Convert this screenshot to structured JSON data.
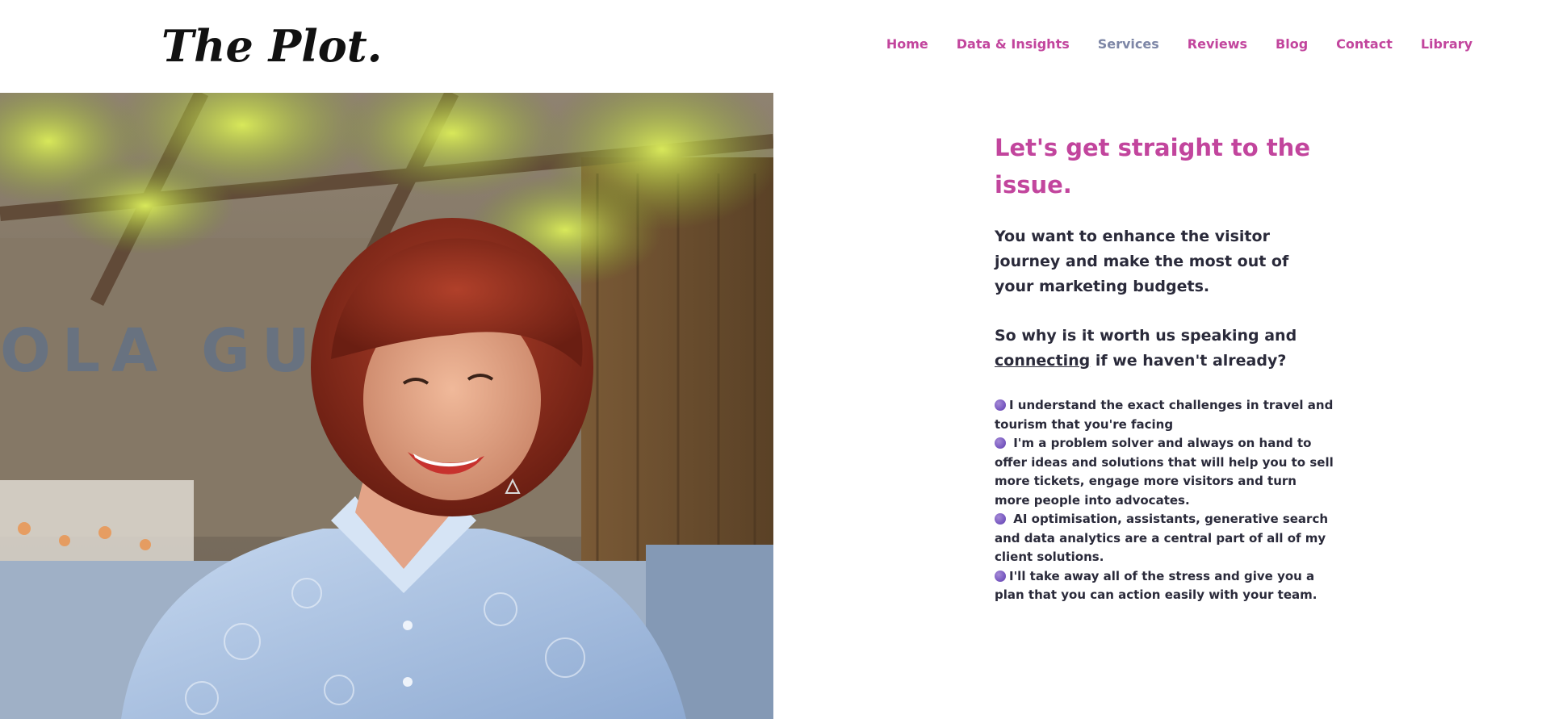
{
  "brand": {
    "logo_text": "The Plot."
  },
  "nav": {
    "items": [
      {
        "label": "Home"
      },
      {
        "label": "Data & Insights"
      },
      {
        "label": "Services"
      },
      {
        "label": "Reviews"
      },
      {
        "label": "Blog"
      },
      {
        "label": "Contact"
      },
      {
        "label": "Library"
      }
    ],
    "active_item": "Services"
  },
  "hero": {
    "photo_alt": "Smiling woman with red bob hair in a light blue embroidered shirt, seated outdoors under a green vine pergola",
    "wall_text": "OLA GUAPA"
  },
  "content": {
    "headline": "Let's get straight to the issue.",
    "lead": "You want to enhance the visitor journey and make the most out of your marketing budgets.",
    "lead2_prefix": "So why is it worth us speaking and ",
    "lead2_link": "connecting",
    "lead2_suffix": " if we haven't already?",
    "bullets": [
      "I understand the exact challenges in travel and tourism that you're facing",
      " I'm a problem solver and always on hand to offer ideas and solutions that will help you to sell more tickets, engage more visitors and turn more people into advocates.",
      " AI optimisation, assistants, generative search and data analytics are a central part of all of my client solutions.",
      "I'll take away all of the stress and give you a plan that you can action easily with your team."
    ]
  },
  "colors": {
    "accent": "#c2459d",
    "nav_active": "#7d86a6",
    "text": "#2a2a3a",
    "bullet_purple": "#7a5bc2"
  }
}
